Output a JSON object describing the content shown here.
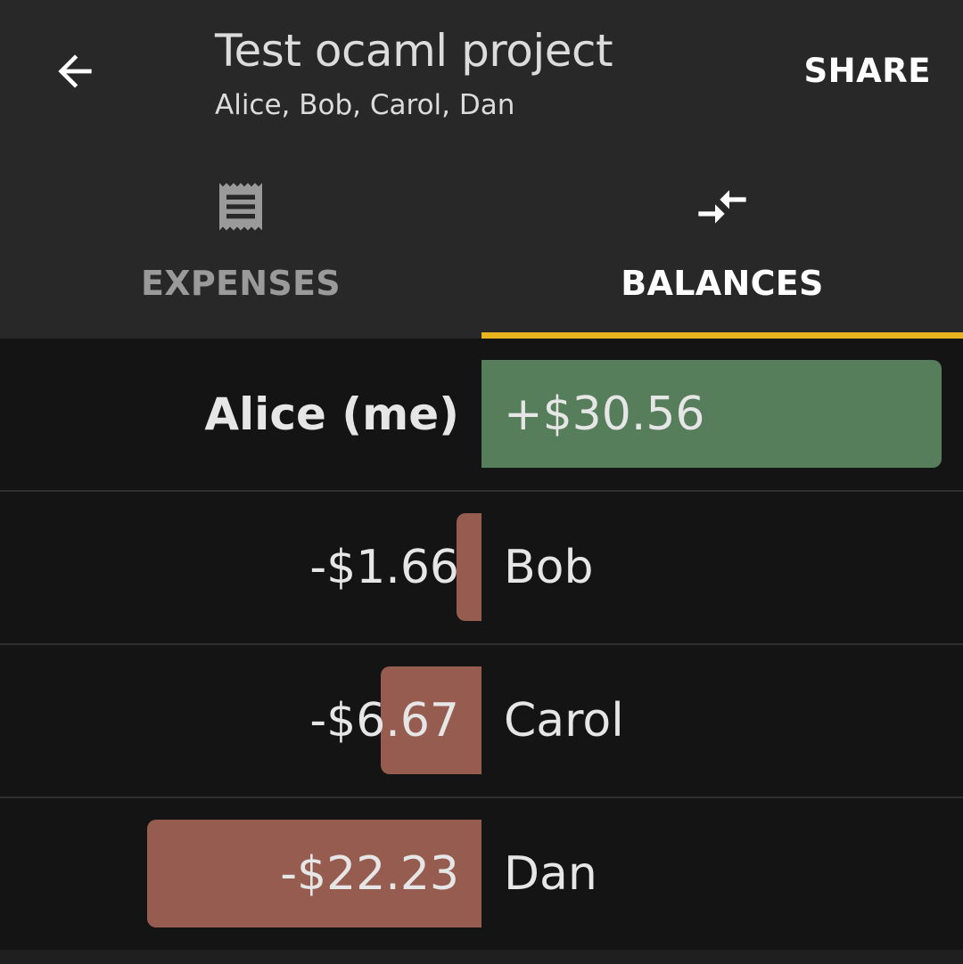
{
  "header": {
    "title": "Test ocaml project",
    "subtitle": "Alice, Bob, Carol, Dan",
    "share_label": "SHARE",
    "back_icon": "arrow-back-icon"
  },
  "tabs": [
    {
      "label": "EXPENSES",
      "icon": "receipt-icon",
      "selected": false
    },
    {
      "label": "BALANCES",
      "icon": "compare-arrows-icon",
      "selected": true
    }
  ],
  "colors": {
    "appbar": "#282828",
    "background": "#141414",
    "indicator": "#e8b320",
    "positive": "#577e5a",
    "negative": "#955c4f"
  },
  "balances": [
    {
      "name": "Alice (me)",
      "amount": "+$30.56",
      "value": 30.56,
      "is_me": true
    },
    {
      "name": "Bob",
      "amount": "-$1.66",
      "value": -1.66,
      "is_me": false
    },
    {
      "name": "Carol",
      "amount": "-$6.67",
      "value": -6.67,
      "is_me": false
    },
    {
      "name": "Dan",
      "amount": "-$22.23",
      "value": -22.23,
      "is_me": false
    }
  ]
}
